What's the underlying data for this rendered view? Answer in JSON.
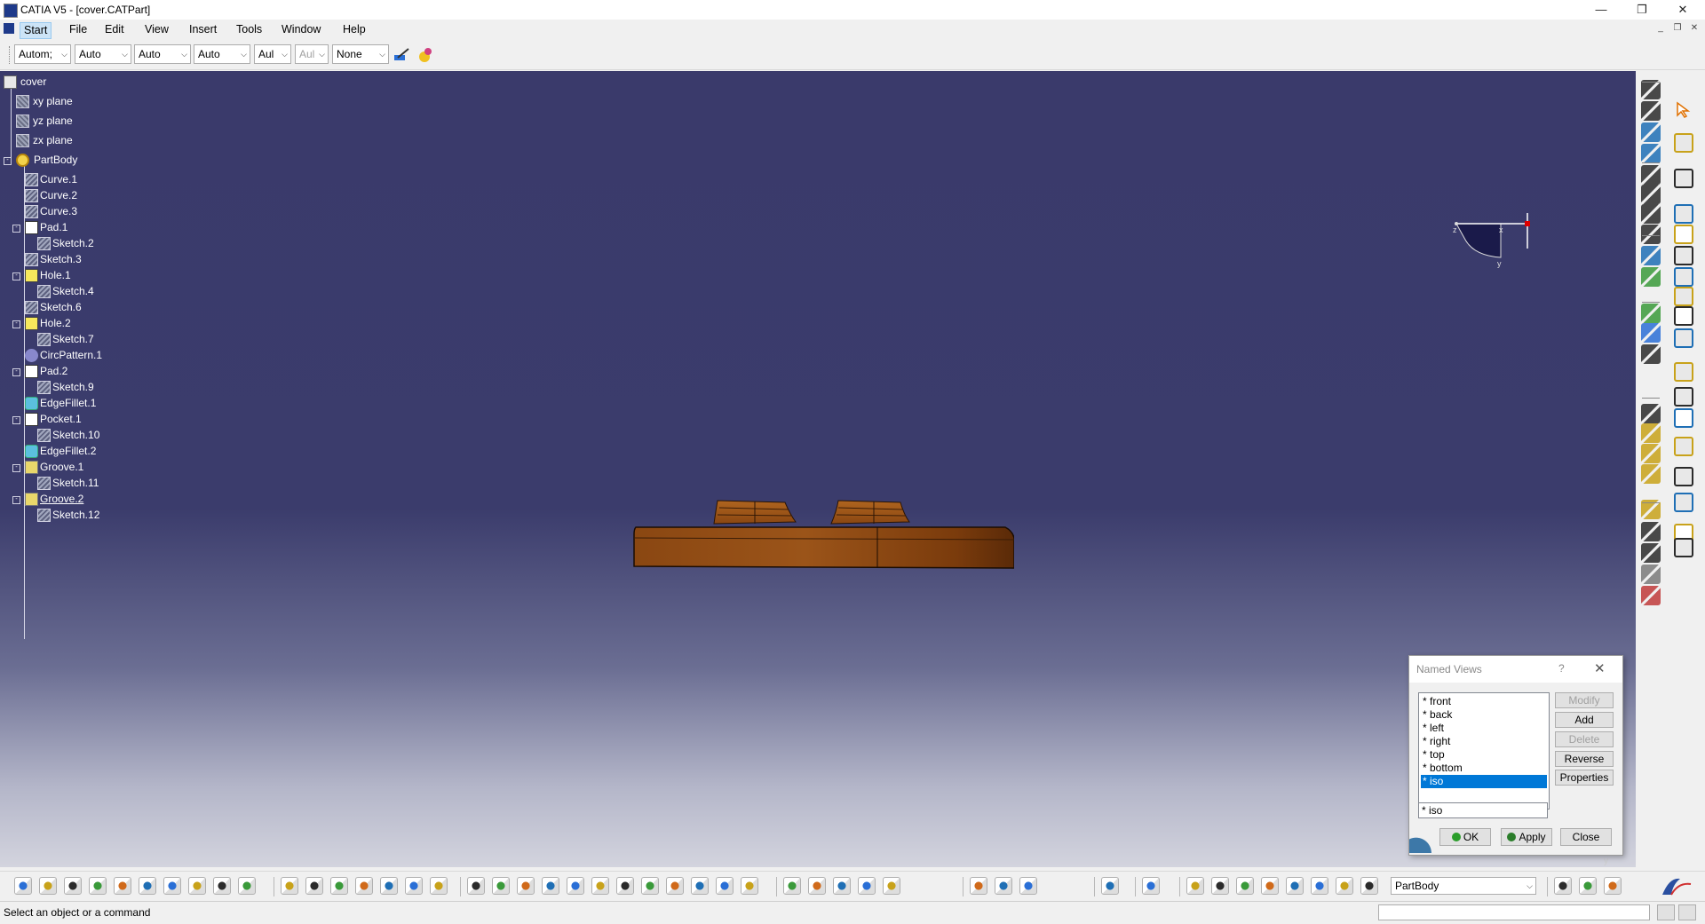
{
  "window": {
    "title": "CATIA V5 - [cover.CATPart]",
    "controls": [
      "minimize-icon",
      "restore-icon",
      "close-icon"
    ]
  },
  "menu": {
    "items": [
      "Start",
      "File",
      "Edit",
      "View",
      "Insert",
      "Tools",
      "Window",
      "Help"
    ],
    "active": "Start"
  },
  "top_toolbar": {
    "combos": [
      "Autom;",
      "Auto",
      "Auto",
      "Auto",
      "Aul",
      "Aul",
      "None"
    ],
    "disabled_index": 5
  },
  "tree": {
    "root": "cover",
    "planes": [
      "xy plane",
      "yz plane",
      "zx plane"
    ],
    "body": "PartBody",
    "features": [
      {
        "label": "Curve.1",
        "kind": "sketch"
      },
      {
        "label": "Curve.2",
        "kind": "sketch"
      },
      {
        "label": "Curve.3",
        "kind": "sketch"
      },
      {
        "label": "Pad.1",
        "kind": "pad",
        "child": "Sketch.2"
      },
      {
        "label": "Sketch.3",
        "kind": "sketch"
      },
      {
        "label": "Hole.1",
        "kind": "hole",
        "child": "Sketch.4"
      },
      {
        "label": "Sketch.6",
        "kind": "sketch"
      },
      {
        "label": "Hole.2",
        "kind": "hole",
        "child": "Sketch.7"
      },
      {
        "label": "CircPattern.1",
        "kind": "pattern"
      },
      {
        "label": "Pad.2",
        "kind": "pad",
        "child": "Sketch.9"
      },
      {
        "label": "EdgeFillet.1",
        "kind": "fillet"
      },
      {
        "label": "Pocket.1",
        "kind": "pocket",
        "child": "Sketch.10"
      },
      {
        "label": "EdgeFillet.2",
        "kind": "fillet"
      },
      {
        "label": "Groove.1",
        "kind": "groove",
        "child": "Sketch.11"
      },
      {
        "label": "Groove.2",
        "kind": "groove",
        "child": "Sketch.12"
      }
    ]
  },
  "compass": {
    "labels": [
      "z",
      "x",
      "y"
    ]
  },
  "named_views": {
    "title": "Named Views",
    "help": "?",
    "items": [
      "* front",
      "* back",
      "* left",
      "* right",
      "* top",
      "* bottom",
      "* iso"
    ],
    "selected": "* iso",
    "name_field": "* iso",
    "side_buttons": [
      {
        "label": "Modify",
        "enabled": false
      },
      {
        "label": "Add",
        "enabled": true
      },
      {
        "label": "Delete",
        "enabled": false
      },
      {
        "label": "Reverse",
        "enabled": true
      },
      {
        "label": "Properties",
        "enabled": true
      }
    ],
    "ok": "OK",
    "apply": "Apply",
    "close": "Close"
  },
  "bottom_toolbar": {
    "current_body": "PartBody"
  },
  "status": {
    "message": "Select an object or a command"
  },
  "colors": {
    "viewport_top": "#3a3a6b",
    "part": "#8b4a14",
    "selection": "#0078d7"
  }
}
